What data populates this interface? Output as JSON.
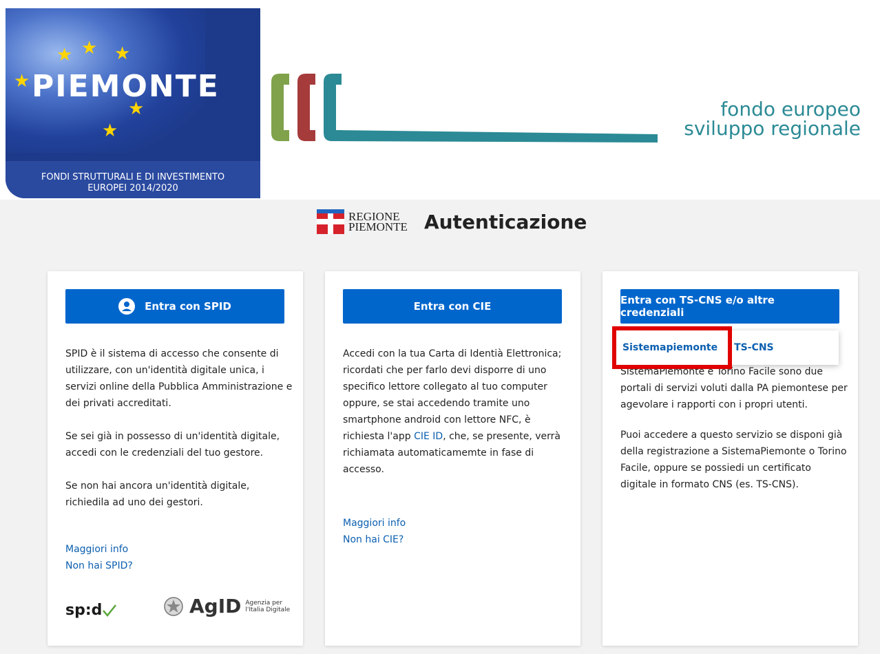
{
  "banner": {
    "eu_logo_text": "PIEMONTE",
    "fund_line1": "FONDI STRUTTURALI E DI INVESTIMENTO",
    "fund_line2": "EUROPEI 2014/2020",
    "fesr_line1": "fondo europeo",
    "fesr_line2": "sviluppo regionale"
  },
  "header": {
    "regione_line1": "REGIONE",
    "regione_line2": "PIEMONTE",
    "title": "Autenticazione"
  },
  "cards": {
    "spid": {
      "button_label": "Entra con SPID",
      "p1": "SPID è il sistema di accesso che consente di utilizzare, con un'identità digitale unica, i servizi online della Pubblica Amministrazione e dei privati accreditati.",
      "p2": "Se sei già in possesso di un'identità digitale, accedi con le credenziali del tuo gestore.",
      "p3": "Se non hai ancora un'identità digitale, richiedila ad uno dei gestori.",
      "link_info": "Maggiori info",
      "link_no": "Non hai SPID?",
      "spid_logo": "sp:d",
      "agid_logo": "AgID",
      "agid_sub1": "Agenzia per",
      "agid_sub2": "l'Italia Digitale"
    },
    "cie": {
      "button_label": "Entra con CIE",
      "p1_before": "Accedi con la tua Carta di Identià Elettronica; ricordati che per farlo devi disporre di uno specifico lettore collegato al tuo computer oppure, se stai accedendo tramite uno smartphone android con lettore NFC, è richiesta l'app ",
      "p1_link": "CIE ID",
      "p1_after": ", che, se presente, verrà richiamata automaticamemte in fase di accesso.",
      "link_info": "Maggiori info",
      "link_no": "Non hai CIE?"
    },
    "tscns": {
      "button_label": "Entra con TS-CNS e/o altre credenziali",
      "dropdown": [
        "Sistemapiemonte",
        "TS-CNS"
      ],
      "p1": "SistemaPiemonte e Torino Facile sono due portali di servizi voluti dalla PA piemontese per agevolare i rapporti con i propri utenti.",
      "p2": "Puoi accedere a questo servizio se disponi già della registrazione a SistemaPiemonte o Torino Facile, oppure se possiedi un certificato digitale in formato CNS (es. TS-CNS)."
    }
  },
  "colors": {
    "primary_button": "#0066cc",
    "link": "#0b5fb0",
    "highlight": "#e00000",
    "fesr_teal": "#2b8a95"
  }
}
